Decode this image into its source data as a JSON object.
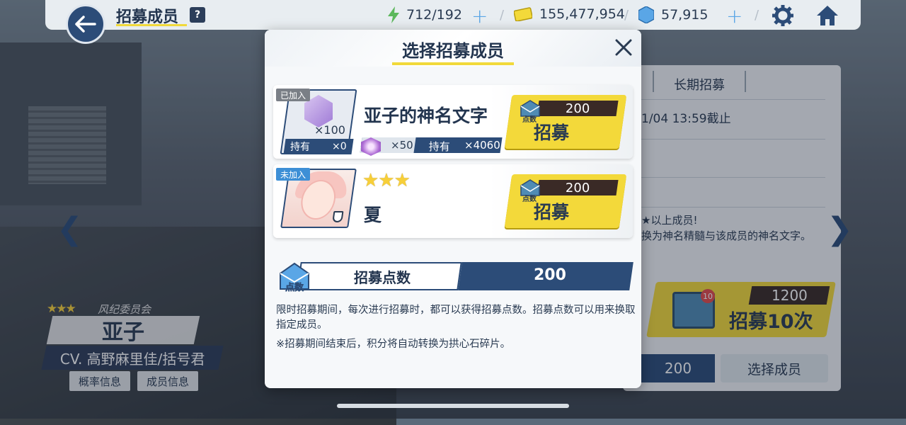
{
  "header": {
    "title": "招募成员",
    "help": "?",
    "stamina": "712/192",
    "credits": "155,477,954",
    "gems": "57,915"
  },
  "character": {
    "stars": "★★★",
    "affiliation": "风纪委员会",
    "name": "亚子",
    "cv": "CV. 高野麻里佳/括号君",
    "btn_rate": "概率信息",
    "btn_info": "成员信息"
  },
  "right_panel": {
    "tab_long": "长期招募",
    "deadline": "1/04 13:59截止",
    "desc_line1": "★以上成员!",
    "desc_line2": "换为神名精髓与该成员的神名文字。",
    "ten_cost": "1200",
    "ten_label": "招募10次",
    "ten_badge": "10",
    "points": "200",
    "select_label": "选择成员"
  },
  "modal": {
    "title": "选择招募成员",
    "items": [
      {
        "tag": "已加入",
        "name": "亚子的神名文字",
        "icon_count": "×100",
        "hold_label": "持有",
        "hold_value": "×0",
        "convert_rate": "×50",
        "convert_hold_label": "持有",
        "convert_hold_value": "×4060",
        "cost": "200",
        "cost_label": "点数",
        "button": "招募"
      },
      {
        "tag": "未加入",
        "stars": "★★★",
        "name": "夏",
        "cost": "200",
        "cost_label": "点数",
        "button": "招募"
      }
    ],
    "points_icon_label": "点数",
    "points_label": "招募点数",
    "points_value": "200",
    "description": "限时招募期间，每次进行招募时，都可以获得招募点数。招募点数可以用来换取指定成员。",
    "note": "※招募期间结束后，积分将自动转换为拱心石碎片。"
  },
  "colors": {
    "accent_yellow": "#f3d93a",
    "navy": "#2c4c78",
    "text_dark": "#23354f"
  }
}
